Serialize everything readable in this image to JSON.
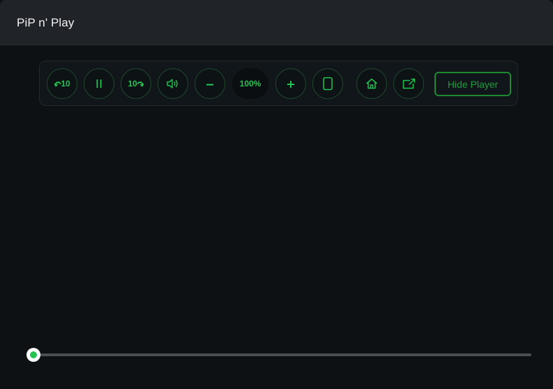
{
  "window": {
    "title": "PiP n' Play"
  },
  "controls": {
    "rewind": {
      "label": "10",
      "icon": "rewind-icon"
    },
    "pause": {
      "icon": "pause-icon"
    },
    "forward": {
      "label": "10",
      "icon": "forward-icon"
    },
    "volume": {
      "icon": "speaker-icon"
    },
    "zoom_out": {
      "icon": "minus-icon"
    },
    "zoom_level": "100%",
    "zoom_in": {
      "icon": "plus-icon"
    },
    "rotate": {
      "icon": "tablet-icon"
    },
    "home": {
      "icon": "home-icon"
    },
    "popout": {
      "icon": "popout-icon"
    },
    "hide_player_label": "Hide Player"
  },
  "seek": {
    "progress": 0
  },
  "colors": {
    "accent": "#23c552",
    "titlebar": "#202327",
    "background": "#0d1114"
  }
}
